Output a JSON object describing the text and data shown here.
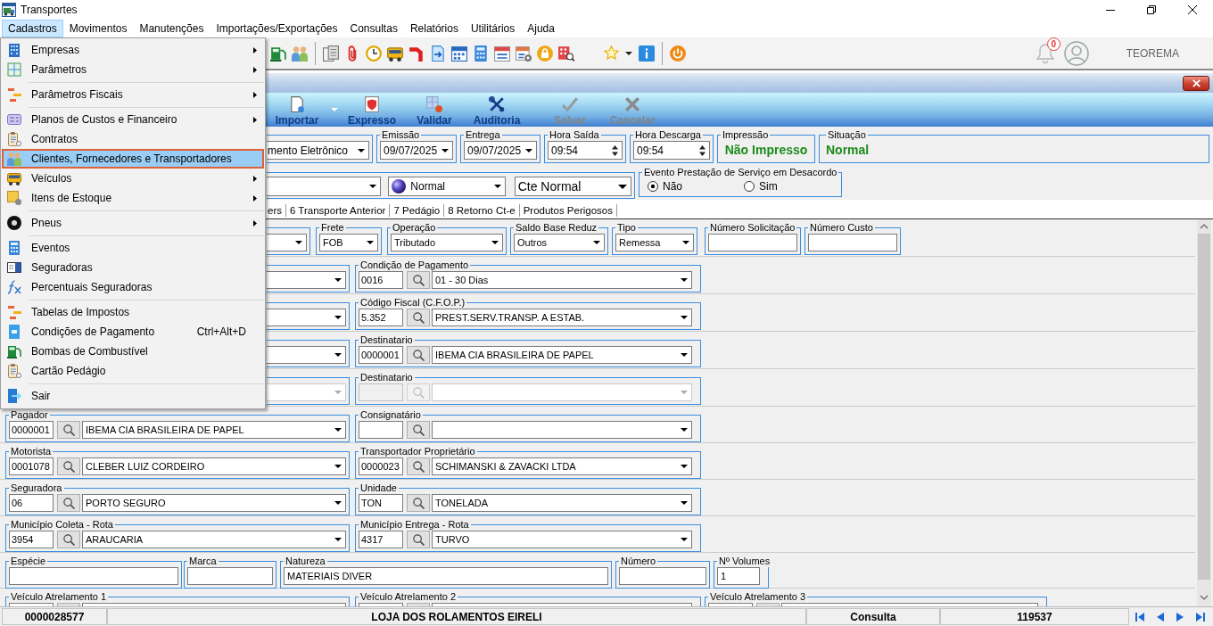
{
  "window": {
    "title": "Transportes"
  },
  "menu_bar": [
    {
      "label": "Cadastros",
      "selected": true
    },
    {
      "label": "Movimentos",
      "selected": false
    },
    {
      "label": "Manutenções",
      "selected": false
    },
    {
      "label": "Importações/Exportações",
      "selected": false
    },
    {
      "label": "Consultas",
      "selected": false
    },
    {
      "label": "Relatórios",
      "selected": false
    },
    {
      "label": "Utilitários",
      "selected": false
    },
    {
      "label": "Ajuda",
      "selected": false
    }
  ],
  "cadastros_menu": [
    {
      "kind": "item",
      "label": "Empresas",
      "submenu": true,
      "selected": false
    },
    {
      "kind": "item",
      "label": "Parâmetros",
      "submenu": true,
      "selected": false
    },
    {
      "kind": "separator"
    },
    {
      "kind": "item",
      "label": "Parâmetros Fiscais",
      "submenu": true,
      "selected": false
    },
    {
      "kind": "separator"
    },
    {
      "kind": "item",
      "label": "Planos de Custos e Financeiro",
      "submenu": true,
      "selected": false
    },
    {
      "kind": "item",
      "label": "Contratos",
      "submenu": false,
      "selected": false
    },
    {
      "kind": "item",
      "label": "Clientes, Fornecedores e Transportadores",
      "submenu": false,
      "selected": true
    },
    {
      "kind": "item",
      "label": "Veículos",
      "submenu": true,
      "selected": false
    },
    {
      "kind": "item",
      "label": "Itens de Estoque",
      "submenu": true,
      "selected": false
    },
    {
      "kind": "separator"
    },
    {
      "kind": "item",
      "label": "Pneus",
      "submenu": true,
      "selected": false
    },
    {
      "kind": "separator"
    },
    {
      "kind": "item",
      "label": "Eventos",
      "submenu": false,
      "selected": false
    },
    {
      "kind": "item",
      "label": "Seguradoras",
      "submenu": false,
      "selected": false
    },
    {
      "kind": "item",
      "label": "Percentuais Seguradoras",
      "submenu": false,
      "selected": false
    },
    {
      "kind": "separator"
    },
    {
      "kind": "item",
      "label": "Tabelas de Impostos",
      "submenu": false,
      "selected": false
    },
    {
      "kind": "item",
      "label": "Condições de Pagamento",
      "shortcut": "Ctrl+Alt+D",
      "submenu": false,
      "selected": false
    },
    {
      "kind": "item",
      "label": "Bombas de Combustível",
      "submenu": false,
      "selected": false
    },
    {
      "kind": "item",
      "label": "Cartão Pedágio",
      "submenu": false,
      "selected": false
    },
    {
      "kind": "separator"
    },
    {
      "kind": "item",
      "label": "Sair",
      "submenu": false,
      "selected": false
    }
  ],
  "toolbar": {
    "notification_count": "0",
    "user_name": "TEOREMA"
  },
  "document_window": {
    "toolbar": [
      {
        "label": "Importar",
        "disabled": false,
        "dropdown": true
      },
      {
        "label": "Expresso",
        "disabled": false,
        "dropdown": false
      },
      {
        "label": "Validar",
        "disabled": false,
        "dropdown": false
      },
      {
        "label": "Auditoria",
        "disabled": false,
        "dropdown": false
      },
      {
        "label": "Salvar",
        "disabled": true,
        "dropdown": false
      },
      {
        "label": "Cancelar",
        "disabled": true,
        "dropdown": false
      }
    ],
    "header_row_1": [
      {
        "kind": "partial_dropdown",
        "value": "mento Eletrônico"
      },
      {
        "kind": "date",
        "label": "Emissão",
        "value": "09/07/2025"
      },
      {
        "kind": "date",
        "label": "Entrega",
        "value": "09/07/2025"
      },
      {
        "kind": "time",
        "label": "Hora Saída",
        "value": "09:54"
      },
      {
        "kind": "time",
        "label": "Hora Descarga",
        "value": "09:54"
      },
      {
        "kind": "status",
        "label": "Impressão",
        "value": "Não Impresso"
      },
      {
        "kind": "status",
        "label": "Situação",
        "value": "Normal"
      }
    ],
    "header_row_2": {
      "selects": [
        {
          "kind": "partial_dropdown"
        },
        {
          "kind": "icon_dropdown",
          "value": "Normal"
        },
        {
          "kind": "large_dropdown",
          "value": "Cte Normal"
        }
      ],
      "desacordo": {
        "label": "Evento Prestação de Serviço em Desacordo",
        "options": [
          {
            "label": "Não",
            "selected": true
          },
          {
            "label": "Sim",
            "selected": false
          }
        ]
      }
    },
    "tabs": [
      {
        "label": "ers",
        "selected": false
      },
      {
        "label": "6 Transporte Anterior",
        "selected": false
      },
      {
        "label": "7 Pedágio",
        "selected": false
      },
      {
        "label": "8 Retorno Ct-e",
        "selected": false
      },
      {
        "label": "Produtos Perigosos",
        "selected": false
      }
    ],
    "field_lines": [
      {
        "groups": [
          {
            "kind": "partial_dropdown",
            "disabled": false
          },
          {
            "kind": "dropdown",
            "label": "Frete",
            "value": "FOB"
          },
          {
            "kind": "dropdown",
            "label": "Operação",
            "value": "Tributado"
          },
          {
            "kind": "dropdown",
            "label": "Saldo Base Reduz",
            "value": "Outros"
          },
          {
            "kind": "dropdown",
            "label": "Tipo",
            "value": "Remessa"
          },
          {
            "kind": "input",
            "label": "Número Solicitação"
          },
          {
            "kind": "input",
            "label": "Número Custo"
          }
        ]
      },
      {
        "groups": [
          {
            "kind": "partial_dropdown",
            "disabled": false
          },
          {
            "kind": "lookup",
            "label": "Condição de Pagamento",
            "code": "0016",
            "value": "01 - 30 Dias",
            "disabled": false
          }
        ]
      },
      {
        "groups": [
          {
            "kind": "partial_dropdown",
            "disabled": false
          },
          {
            "kind": "lookup",
            "label": "Código Fiscal (C.F.O.P.)",
            "code": "5.352",
            "value": "PREST.SERV.TRANSP. A ESTAB.",
            "disabled": false
          }
        ]
      },
      {
        "groups": [
          {
            "kind": "partial_dropdown",
            "disabled": false
          },
          {
            "kind": "lookup",
            "label": "Destinatario",
            "code": "0000001",
            "value": "IBEMA CIA BRASILEIRA DE PAPEL",
            "disabled": false
          }
        ]
      },
      {
        "groups": [
          {
            "kind": "partial_dropdown",
            "disabled": true
          },
          {
            "kind": "lookup",
            "label": "Destinatario",
            "disabled": true
          }
        ]
      },
      {
        "groups": [
          {
            "kind": "lookup",
            "label": "Pagador",
            "code": "0000001",
            "value": "IBEMA CIA BRASILEIRA DE PAPEL",
            "disabled": false
          },
          {
            "kind": "lookup",
            "label": "Consignatário",
            "disabled": false
          }
        ]
      },
      {
        "groups": [
          {
            "kind": "lookup",
            "label": "Motorista",
            "code": "0001078",
            "value": "CLEBER LUIZ CORDEIRO",
            "disabled": false
          },
          {
            "kind": "lookup",
            "label": "Transportador Proprietário",
            "code": "0000023",
            "value": "SCHIMANSKI & ZAVACKI LTDA",
            "disabled": false
          }
        ]
      },
      {
        "groups": [
          {
            "kind": "lookup",
            "label": "Seguradora",
            "code": "06",
            "value": "PORTO SEGURO",
            "disabled": false
          },
          {
            "kind": "lookup",
            "label": "Unidade",
            "code": "TON",
            "value": "TONELADA",
            "disabled": false
          }
        ]
      },
      {
        "groups": [
          {
            "kind": "lookup",
            "label": "Município Coleta - Rota",
            "code": "3954",
            "value": "ARAUCARIA",
            "disabled": false
          },
          {
            "kind": "lookup",
            "label": "Município Entrega - Rota",
            "code": "4317",
            "value": "TURVO",
            "disabled": false
          }
        ]
      },
      {
        "groups": [
          {
            "kind": "input",
            "label": "Espécie"
          },
          {
            "kind": "input",
            "label": "Marca"
          },
          {
            "kind": "input",
            "label": "Natureza",
            "value": "MATERIAIS DIVER"
          },
          {
            "kind": "input",
            "label": "Número"
          },
          {
            "kind": "input",
            "label": "Nº Volumes",
            "value": "1"
          }
        ]
      },
      {
        "groups": [
          {
            "kind": "lookup",
            "label": "Veículo Atrelamento 1",
            "disabled": false
          },
          {
            "kind": "lookup",
            "label": "Veículo Atrelamento 2",
            "disabled": false
          },
          {
            "kind": "lookup",
            "label": "Veículo Atrelamento 3",
            "disabled": false
          }
        ]
      }
    ],
    "status_bar": [
      "0000028577",
      "LOJA DOS ROLAMENTOS EIRELI",
      "Consulta",
      "119537"
    ]
  }
}
